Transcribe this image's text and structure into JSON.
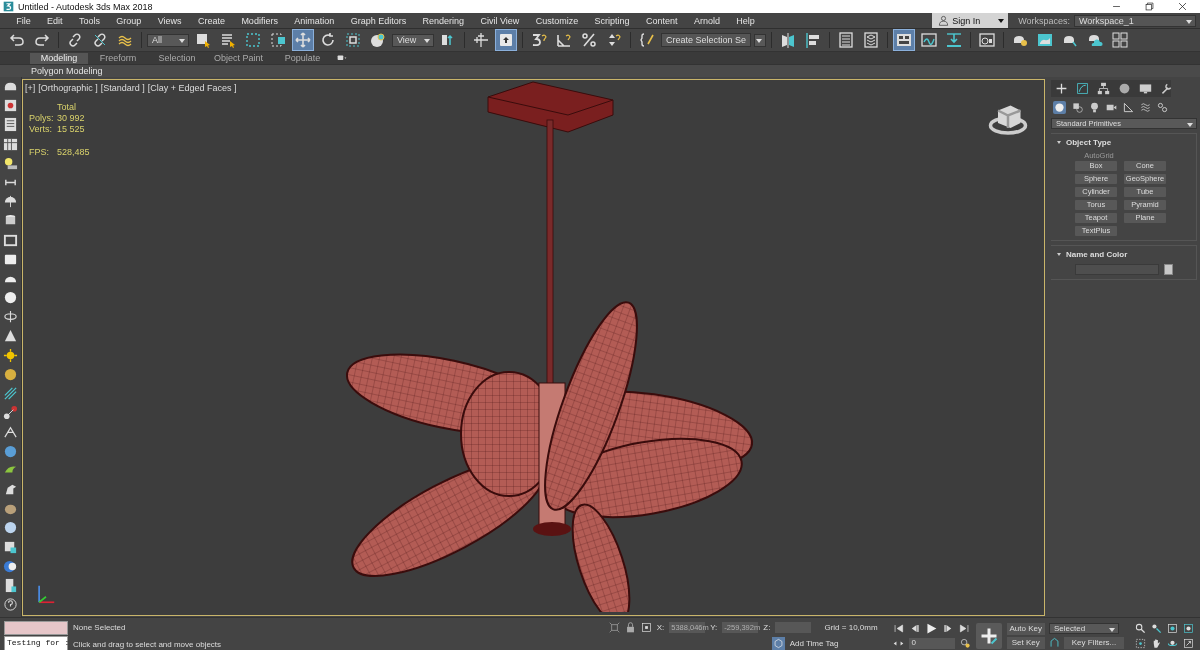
{
  "window": {
    "title": "Untitled - Autodesk 3ds Max 2018"
  },
  "menu": [
    "File",
    "Edit",
    "Tools",
    "Group",
    "Views",
    "Create",
    "Modifiers",
    "Animation",
    "Graph Editors",
    "Rendering",
    "Civil View",
    "Customize",
    "Scripting",
    "Content",
    "Arnold",
    "Help"
  ],
  "account": {
    "sign_in": "Sign In",
    "workspaces_label": "Workspaces:",
    "workspace": "Workspace_1"
  },
  "toolbar": {
    "selection_filter": "All",
    "reference_coord": "View",
    "named_selection": "Create Selection Se"
  },
  "ribbon": {
    "tabs": [
      {
        "label": "Modeling",
        "selected": true
      },
      {
        "label": "Freeform",
        "selected": false
      },
      {
        "label": "Selection",
        "selected": false
      },
      {
        "label": "Object Paint",
        "selected": false
      },
      {
        "label": "Populate",
        "selected": false
      }
    ],
    "panel": "Polygon Modeling"
  },
  "viewport": {
    "labels": [
      "[+]",
      "[Orthographic ]",
      "[Standard ]",
      "[Clay + Edged Faces ]"
    ],
    "stats_header": "Total",
    "stats": [
      {
        "label": "Polys:",
        "value": "30 992"
      },
      {
        "label": "Verts:",
        "value": "15 525"
      }
    ],
    "fps": {
      "label": "FPS:",
      "value": "528,485"
    }
  },
  "command_panel": {
    "category": "Standard Primitives",
    "object_type": {
      "title": "Object Type",
      "expanded": true,
      "autogrid": {
        "label": "AutoGrid",
        "disabled": true
      },
      "buttons": [
        "Box",
        "Cone",
        "Sphere",
        "GeoSphere",
        "Cylinder",
        "Tube",
        "Torus",
        "Pyramid",
        "Teapot",
        "Plane",
        "TextPlus"
      ]
    },
    "name_and_color": {
      "title": "Name and Color",
      "expanded": true
    }
  },
  "status": {
    "listener": "Testing for :",
    "selection": "None Selected",
    "prompt": "Click and drag to select and move objects",
    "x_label": "X:",
    "x": "5388,046m",
    "y_label": "Y:",
    "y": "-259,392m",
    "z_label": "Z:",
    "grid": "Grid = 10,0mm",
    "time_tag": "Add Time Tag",
    "frame": "0",
    "auto_key": "Auto Key",
    "set_key": "Set Key",
    "key_set": "Selected",
    "key_filters": "Key Filters..."
  }
}
